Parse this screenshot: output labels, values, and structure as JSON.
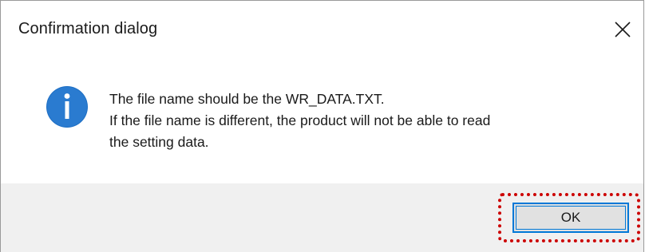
{
  "dialog": {
    "title": "Confirmation dialog",
    "close_icon": "close-icon",
    "info_icon": "info-icon",
    "message_lines": [
      "The file name should be the WR_DATA.TXT.",
      "If the file name is different, the product will not be able to read",
      "the setting data."
    ],
    "ok_label": "OK"
  },
  "colors": {
    "info_icon_fill": "#1e6fc4",
    "button_focus_border": "#0078d7",
    "highlight": "#cc0000",
    "footer_bg": "#f0f0f0"
  }
}
